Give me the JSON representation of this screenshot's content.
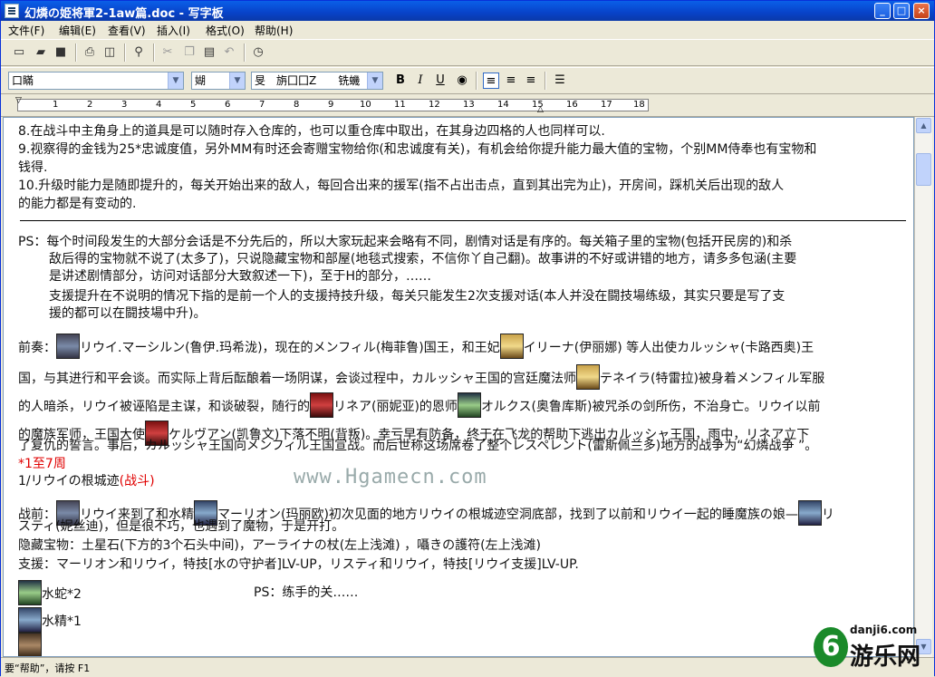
{
  "window": {
    "title": "幻燐の姫将軍2-1aw篇.doc - 写字板",
    "buttons": {
      "minimize": "_",
      "maximize": "□",
      "close": "×"
    }
  },
  "menu": [
    "文件(F)",
    "编辑(E)",
    "查看(V)",
    "插入(I)",
    "格式(O)",
    "帮助(H)"
  ],
  "toolbar_icons": [
    "new-icon",
    "open-icon",
    "save-icon",
    "print-icon",
    "print-preview-icon",
    "find-icon",
    "cut-icon",
    "copy-icon",
    "paste-icon",
    "undo-icon",
    "date-time-icon"
  ],
  "format": {
    "font": "口瞞",
    "size": "媩",
    "script": "旻　旃囗囗Z　　铣蟣",
    "bold": "B",
    "italic": "I",
    "underline": "U"
  },
  "ruler": [
    "1",
    "2",
    "3",
    "4",
    "5",
    "6",
    "7",
    "8",
    "9",
    "10",
    "11",
    "12",
    "13",
    "14",
    "15",
    "16",
    "17",
    "18"
  ],
  "doc": {
    "l1": "8.在战斗中主角身上的道具是可以随时存入仓库的，也可以重仓库中取出，在其身边四格的人也同样可以.",
    "l2": "9.视察得的金钱为25*忠诚度值，另外MM有时还会寄赠宝物给你(和忠诚度有关)，有机会给你提升能力最大值的宝物，个别MM侍奉也有宝物和",
    "l3": "钱得.",
    "l4": "10.升级时能力是随即提升的，每关开始出来的敌人，每回合出来的援军(指不占出击点，直到其出完为止)，开房间，踩机关后出现的敌人",
    "l5": "的能力都是有变动的.",
    "ps1": "PS：每个时间段发生的大部分会话是不分先后的，所以大家玩起来会略有不同，剧情对话是有序的。每关箱子里的宝物(包括开民房的)和杀",
    "ps2": "敌后得的宝物就不说了(太多了)，只说隐藏宝物和部屋(地毯式搜索，不信你丫自己翻)。故事讲的不好或讲错的地方，请多多包涵(主要",
    "ps3": "是讲述剧情部分，访问对话部分大致叙述一下)，至于H的部分，……",
    "ps4": "支援提升在不说明的情况下指的是前一个人的支援持技升级，每关只能发生2次支援对话(本人并没在闘技場练级，其实只要是写了支",
    "ps5": "援的都可以在闘技場中升)。",
    "p1a": "前奏：",
    "p1b": "リウイ.マーシルン(鲁伊.玛希泷)，现在的メンフィル(梅菲鲁)国王，和王妃",
    "p1c": "イリーナ(伊丽娜) 等人出使カルッシャ(卡路西奥)王",
    "p2a": "国，与其进行和平会谈。而实际上背后酝酿着一场阴谋，会谈过程中，カルッシャ王国的宫廷魔法师",
    "p2b": "テネイラ(特雷拉)被身着メンフィル军服",
    "p3a": "的人暗杀，リウイ被诬陷是主谋，和谈破裂，随行的",
    "p3b": "リネア(丽妮亚)的恩师",
    "p3c": "オルクス(奥鲁库斯)被咒杀の剑所伤，不治身亡。リウイ以前",
    "p4a": "的魔族军师，王国大使",
    "p4b": "ケルヴアン(凯鲁文)下落不明(背叛)。幸亏早有防备，终于在飞龙的帮助下逃出カルッシャ王国，雨中，リネア立下",
    "p5": "了复仇的誓言。事后，カルッシャ王国向メンフィル王国宣战。而后世称这场席卷了整个レスペレント(雷斯佩兰多)地方的战争为“幻燐战争 ”。",
    "week": "*1至7周",
    "stage": "1/リウイの根城迹",
    "battle": "(战斗)",
    "b1a": "战前：",
    "b1b": "リウイ来到了和水精",
    "b1c": "マーリオン(玛丽欧)初次见面的地方リウイの根城迹空洞底部，找到了以前和リウイ一起的睡魔族の娘—",
    "b1d": "リ",
    "b2": "スティ(妮丝迪)，但是很不巧，也遇到了魔物，于是开打。",
    "hidden": "隐藏宝物：土星石(下方的3个石头中间)，アーライナの杖(左上浅滩) ，囁きの護符(左上浅滩)",
    "support": "支援：マーリオン和リウイ，特技[水の守护者]LV-UP，リスティ和リウイ，特技[リウイ支援]LV-UP.",
    "e1": "水蛇*2",
    "e1ps": "PS：练手的关……",
    "e2": "水精*1"
  },
  "watermark": "www.Hgamecn.com",
  "status": "要“帮助”，请按 F1",
  "logo": {
    "site": "danji6.com",
    "name": "游乐网"
  }
}
